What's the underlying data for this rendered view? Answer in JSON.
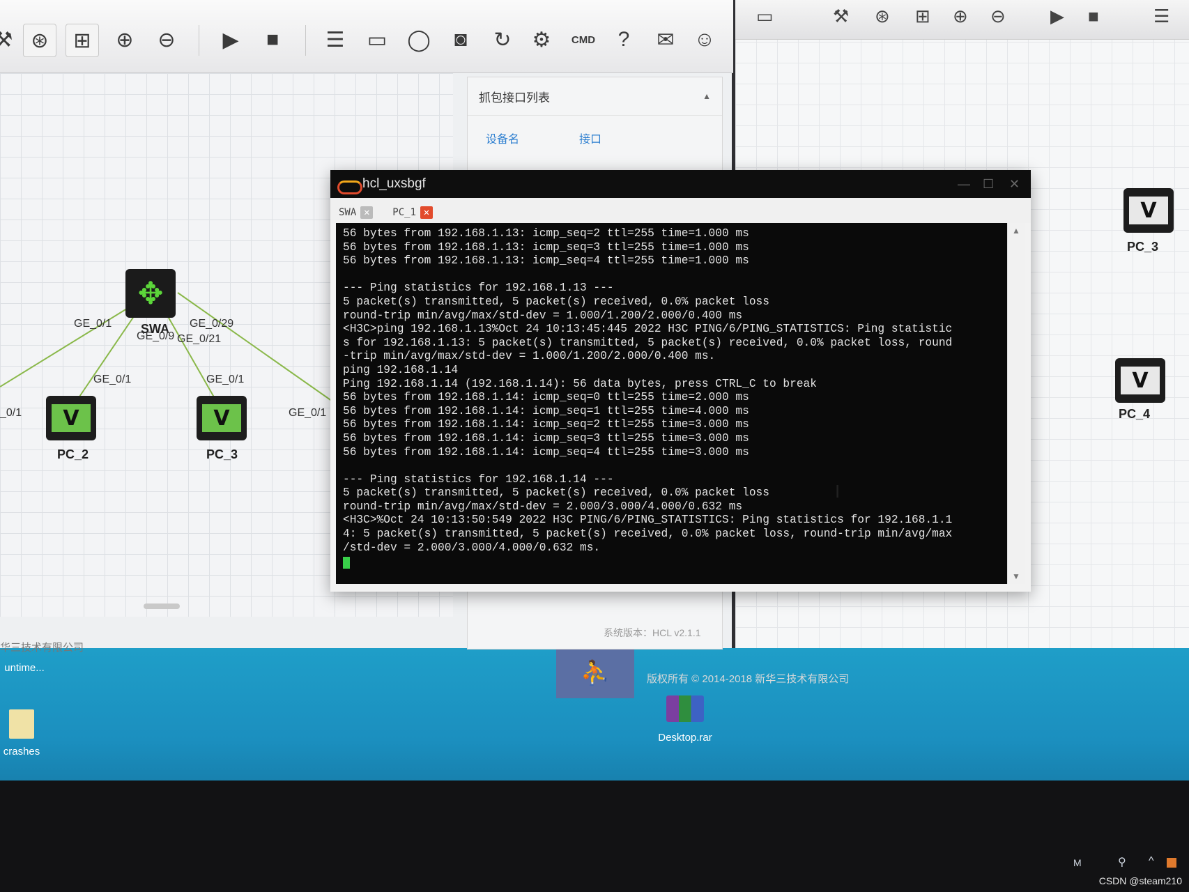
{
  "toolbar": {
    "icons": [
      "tool-icon",
      "topology-icon",
      "grid-icon",
      "zoom-in-icon",
      "zoom-out-icon",
      "play-icon",
      "stop-icon",
      "list-add-icon",
      "rect-add-icon",
      "circle-add-icon",
      "camera-icon",
      "refresh-icon",
      "gear-icon",
      "cmd-icon",
      "help-icon",
      "wechat-icon",
      "user-icon"
    ],
    "cmd_label": "CMD",
    "help_label": "?"
  },
  "capture_panel": {
    "title": "抓包接口列表",
    "col_device": "设备名",
    "col_interface": "接口"
  },
  "topology": {
    "switch_label": "SWA",
    "pcs": [
      "PC_2",
      "PC_3"
    ],
    "ports": {
      "a": "GE_0/1",
      "b": "GE_0/29",
      "c": "GE_0/9",
      "d": "GE_0/21",
      "e": "GE_0/1",
      "f": "GE_0/1",
      "g": "GE_0/1",
      "h": "_0/1"
    },
    "pc_glyph": "V"
  },
  "status": {
    "version": "系统版本：HCL v2.1.1",
    "company": "华三技术有限公司"
  },
  "right_window": {
    "pcs": [
      "PC_3",
      "PC_4"
    ],
    "copyright": "版权所有 © 2014-2018 新华三技术有限公司"
  },
  "terminal": {
    "title": "hcl_uxsbgf",
    "tabs": [
      {
        "label": "SWA",
        "active": false
      },
      {
        "label": "PC_1",
        "active": true
      }
    ],
    "lines": [
      "56 bytes from 192.168.1.13: icmp_seq=2 ttl=255 time=1.000 ms",
      "56 bytes from 192.168.1.13: icmp_seq=3 ttl=255 time=1.000 ms",
      "56 bytes from 192.168.1.13: icmp_seq=4 ttl=255 time=1.000 ms",
      "",
      "--- Ping statistics for 192.168.1.13 ---",
      "5 packet(s) transmitted, 5 packet(s) received, 0.0% packet loss",
      "round-trip min/avg/max/std-dev = 1.000/1.200/2.000/0.400 ms",
      "<H3C>ping 192.168.1.13%Oct 24 10:13:45:445 2022 H3C PING/6/PING_STATISTICS: Ping statistic",
      "s for 192.168.1.13: 5 packet(s) transmitted, 5 packet(s) received, 0.0% packet loss, round",
      "-trip min/avg/max/std-dev = 1.000/1.200/2.000/0.400 ms.",
      "ping 192.168.1.14",
      "Ping 192.168.1.14 (192.168.1.14): 56 data bytes, press CTRL_C to break",
      "56 bytes from 192.168.1.14: icmp_seq=0 ttl=255 time=2.000 ms",
      "56 bytes from 192.168.1.14: icmp_seq=1 ttl=255 time=4.000 ms",
      "56 bytes from 192.168.1.14: icmp_seq=2 ttl=255 time=3.000 ms",
      "56 bytes from 192.168.1.14: icmp_seq=3 ttl=255 time=3.000 ms",
      "56 bytes from 192.168.1.14: icmp_seq=4 ttl=255 time=3.000 ms",
      "",
      "--- Ping statistics for 192.168.1.14 ---",
      "5 packet(s) transmitted, 5 packet(s) received, 0.0% packet loss",
      "round-trip min/avg/max/std-dev = 2.000/3.000/4.000/0.632 ms",
      "<H3C>%Oct 24 10:13:50:549 2022 H3C PING/6/PING_STATISTICS: Ping statistics for 192.168.1.1",
      "4: 5 packet(s) transmitted, 5 packet(s) received, 0.0% packet loss, round-trip min/avg/max",
      "/std-dev = 2.000/3.000/4.000/0.632 ms."
    ]
  },
  "desktop": {
    "icons": [
      {
        "label": "crashes",
        "icon": "folder-icon"
      },
      {
        "label": "Desktop.rar",
        "icon": "winrar-archive-icon"
      }
    ],
    "partial_label": "untime..."
  },
  "watermark": "CSDN @steam210",
  "colors": {
    "terminal_bg": "#0a0a0a",
    "terminal_fg": "#e3e3e3",
    "cursor": "#39d04a",
    "switch_icon": "#5cd63a",
    "pc_screen": "#6cc24a",
    "link": "#2d7fd0",
    "desktop": "#1b8fbf"
  }
}
